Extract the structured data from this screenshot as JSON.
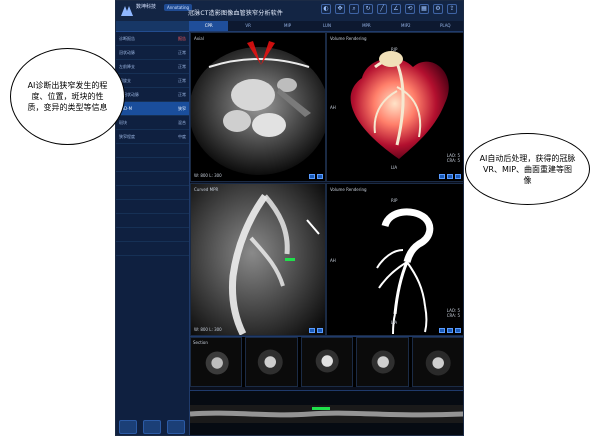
{
  "topbar": {
    "brand_line1": "数坤科技",
    "badge": "Annotating",
    "title": "冠脉CT造影图像血管狭窄分析软件"
  },
  "tabs": [
    "CPR",
    "VR",
    "MIP",
    "LUN",
    "MPR",
    "MIP2",
    "PLAQ"
  ],
  "tab_active_index": 0,
  "sidebar": {
    "header_left": "诊断报告",
    "header_right": "报告",
    "rows": [
      {
        "left": "冠状动脉",
        "right": "正常"
      },
      {
        "left": "左前降支",
        "right": "正常"
      },
      {
        "left": "回旋支",
        "right": "正常"
      },
      {
        "left": "右冠状动脉",
        "right": "正常"
      },
      {
        "left": "LAD-M",
        "right": "狭窄"
      },
      {
        "left": "斑块",
        "right": "混合"
      },
      {
        "left": "狭窄程度",
        "right": "中度"
      },
      {
        "left": "",
        "right": ""
      },
      {
        "left": "",
        "right": ""
      },
      {
        "left": "",
        "right": ""
      },
      {
        "left": "",
        "right": ""
      },
      {
        "left": "",
        "right": ""
      },
      {
        "left": "",
        "right": ""
      },
      {
        "left": "",
        "right": ""
      },
      {
        "left": "",
        "right": ""
      }
    ],
    "active_row": 4
  },
  "viewports": {
    "tl": {
      "label_top": "Axial",
      "label_bl": "W: 800 L: 300"
    },
    "tr": {
      "label_top": "Volume Rendering",
      "label_right": "RIP",
      "label_left": "AH",
      "label_bottom": "LIA",
      "label_right_mid": "LAO: 5\nCRA: 5"
    },
    "bl": {
      "label_top": "Curved MPR",
      "label_bl": "W: 800 L: 300"
    },
    "br": {
      "label_top": "Volume Rendering",
      "label_right": "RIP",
      "label_left": "AH",
      "label_bottom": "LIA",
      "label_right_mid": "LAO: 5\nCRA: 5"
    }
  },
  "strip_label": "Section",
  "callouts": {
    "left_text": "AI诊断出狭窄发生的程度、位置，斑块的性质，变异的类型等信息",
    "right_text": "AI自动后处理，获得的冠脉VR、MIP、曲面重建等图像"
  }
}
